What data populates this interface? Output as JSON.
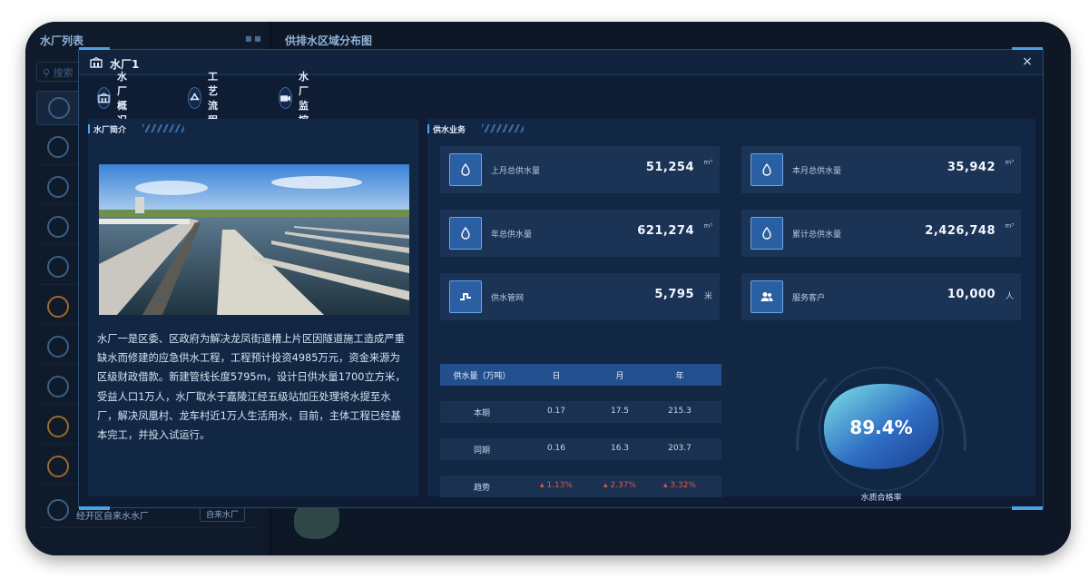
{
  "background": {
    "left_panel_title": "水厂列表",
    "search_placeholder": "搜索",
    "right_panel_title": "供排水区域分布图",
    "bottom_item_label": "经开区自来水水厂",
    "bottom_item_tag": "自来水厂"
  },
  "modal": {
    "title": "水厂1",
    "close_label": "×"
  },
  "tabs": [
    {
      "label": "水厂概况",
      "icon": "building-icon"
    },
    {
      "label": "工艺流程",
      "icon": "recycle-icon"
    },
    {
      "label": "水厂监控",
      "icon": "camera-icon"
    }
  ],
  "intro_section": {
    "title": "水厂简介",
    "text": "水厂一是区委、区政府为解决龙凤街道槽上片区因隧道施工造成严重缺水而修建的应急供水工程，工程预计投资4985万元，资金来源为区级财政借款。新建管线长度5795m，设计日供水量1700立方米，受益人口1万人，水厂取水于嘉陵江经五级站加压处理将水提至水厂，解决凤凰村、龙车村近1万人生活用水，目前，主体工程已经基本完工，并投入试运行。"
  },
  "supply_section": {
    "title": "供水业务",
    "stats": [
      {
        "label": "上月总供水量",
        "value": "51,254",
        "unit": "m³",
        "icon": "water-drop-icon"
      },
      {
        "label": "本月总供水量",
        "value": "35,942",
        "unit": "m³",
        "icon": "water-drop-icon"
      },
      {
        "label": "年总供水量",
        "value": "621,274",
        "unit": "m³",
        "icon": "water-drop-icon"
      },
      {
        "label": "累计总供水量",
        "value": "2,426,748",
        "unit": "m³",
        "icon": "water-drop-icon"
      },
      {
        "label": "供水管网",
        "value": "5,795",
        "unit": "米",
        "icon": "pipe-icon"
      },
      {
        "label": "服务客户",
        "value": "10,000",
        "unit": "人",
        "icon": "users-icon"
      }
    ],
    "table": {
      "headers": [
        "供水量（万吨）",
        "日",
        "月",
        "年"
      ],
      "rows": [
        {
          "name": "本期",
          "day": "0.17",
          "month": "17.5",
          "year": "215.3"
        },
        {
          "name": "同期",
          "day": "0.16",
          "month": "16.3",
          "year": "203.7"
        },
        {
          "name": "趋势",
          "day": "1.13%",
          "month": "2.37%",
          "year": "3.32%"
        }
      ],
      "trend_color": "#e0564b"
    },
    "quality": {
      "value": "89.4%",
      "fraction": 0.894,
      "label": "水质合格率"
    }
  },
  "colors": {
    "accent": "#4aa3e0",
    "panel": "#122744",
    "stat_bg": "#1b3355",
    "header_row": "#22508f"
  }
}
